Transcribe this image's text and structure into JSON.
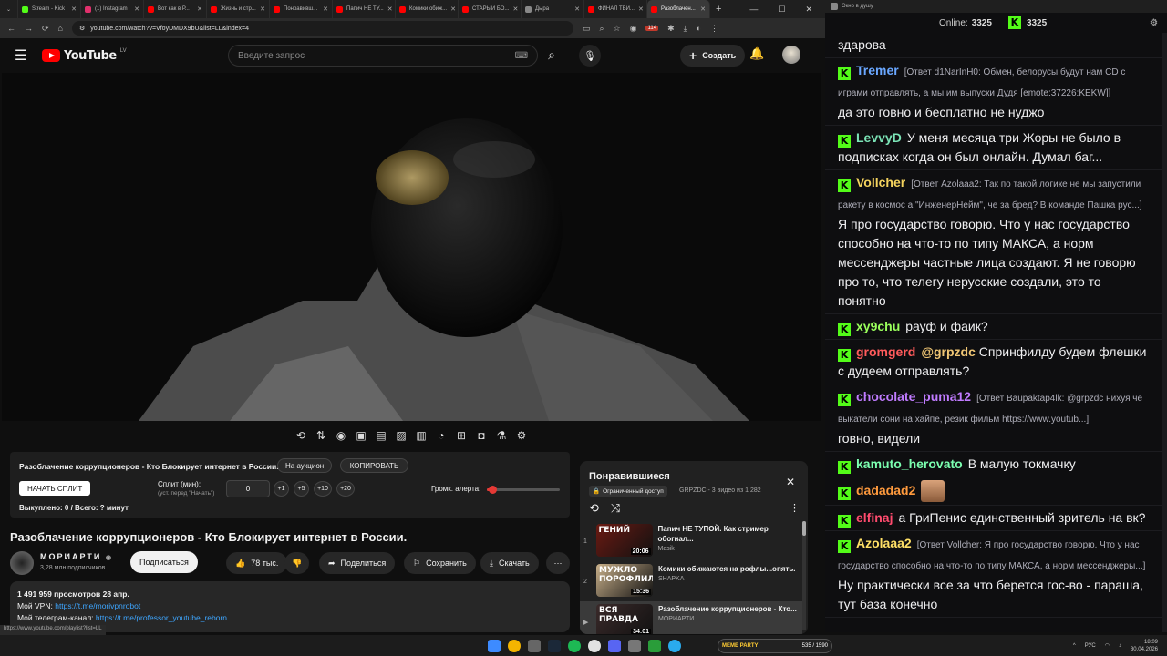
{
  "browser": {
    "tabs": [
      {
        "label": "Stream - Kick",
        "color": "#53fc18"
      },
      {
        "label": "(1) Instagram",
        "color": "#e1306c"
      },
      {
        "label": "Вот как в Р...",
        "color": "#ff0000"
      },
      {
        "label": "Жизнь и стр...",
        "color": "#ff0000"
      },
      {
        "label": "Понравивш...",
        "color": "#ff0000"
      },
      {
        "label": "Папич НЕ ТУ...",
        "color": "#ff0000"
      },
      {
        "label": "Комики обиж...",
        "color": "#ff0000"
      },
      {
        "label": "СТАРЫЙ БО...",
        "color": "#ff0000"
      },
      {
        "label": "Дыра",
        "color": "#888888"
      },
      {
        "label": "ФИНАЛ ТВИ...",
        "color": "#ff0000"
      },
      {
        "label": "Разоблачен...",
        "color": "#ff0000"
      }
    ],
    "url": "youtube.com/watch?v=VfoyDMDX9bU&list=LL&index=4",
    "status_url": "https://www.youtube.com/playlist?list=LL",
    "badge": "114"
  },
  "yt": {
    "logo": "YouTube",
    "region": "LV",
    "search_placeholder": "Введите запрос",
    "create": "Создать"
  },
  "split": {
    "title": "Разоблачение коррупционеров - Кто Блокирует интернет в России.",
    "auction": "На аукцион",
    "copy": "КОПИРОВАТЬ",
    "start": "НАЧАТЬ СПЛИТ",
    "split_label": "Сплит (мин):",
    "split_hint": "(уст. перед \"Начать\")",
    "value": "0",
    "b1": "+1",
    "b5": "+5",
    "b10": "+10",
    "b20": "+20",
    "volume_label": "Громк. алерта:",
    "volume": 0.08,
    "done": "Выкуплено: 0 / Всего: ? минут"
  },
  "video": {
    "title": "Разоблачение коррупционеров - Кто Блокирует интернет в России.",
    "channel": "МОРИАРТИ",
    "subs": "3,28 млн подписчиков",
    "subscribe": "Подписаться",
    "likes": "78 тыс.",
    "share": "Поделиться",
    "save": "Сохранить",
    "download": "Скачать",
    "views": "1 491 959 просмотров  28 апр.",
    "vpn_label": "Мой VPN: ",
    "vpn_link": "https://t.me/morivpnrobot",
    "tg_label": "Мой телеграм-канал: ",
    "tg_link": "https://t.me/professor_youtube_reborn"
  },
  "playlist": {
    "title": "Понравившиеся",
    "access": "Ограниченный доступ",
    "meta": "GRPZDC - 3 видео из 1 282",
    "items": [
      {
        "num": "1",
        "title": "Папич НЕ ТУПОЙ. Как стример обогнал...",
        "channel": "Masik",
        "dur": "20:06",
        "thumb_text": "ГЕНИЙ",
        "color": "#6b1a12"
      },
      {
        "num": "2",
        "title": "Комики обижаются на рофлы...опять.",
        "channel": "SHAPKA",
        "dur": "15:36",
        "thumb_text": "МУЖЛО ПОРОФЛИЛ",
        "color": "#c9b08a"
      },
      {
        "num": "▶",
        "title": "Разоблачение коррупционеров - Кто...",
        "channel": "МОРИАРТИ",
        "dur": "34:01",
        "thumb_text": "ВСЯ ПРАВДА",
        "color": "#3a2a2a"
      }
    ]
  },
  "chat": {
    "window_title": "Окно в душу",
    "online_label": "Online:",
    "online": "3325",
    "kick_count": "3325",
    "messages": [
      {
        "user": "",
        "color": "#fff",
        "reply": "",
        "text": "здарова"
      },
      {
        "user": "Tremer",
        "color": "#6aa7ff",
        "reply": "[Ответ d1NarInH0: Обмен, белорусы будут нам CD с играми отправлять, а мы им выпуски Дудя [emote:37226:KEKW]]",
        "text": "да это говно и бесплатно не нуджо"
      },
      {
        "user": "LevvyD",
        "color": "#7be3b6",
        "reply": "",
        "text": "У меня месяца три Жоры не было в подписках когда он был онлайн. Думал баг..."
      },
      {
        "user": "Vollcher",
        "color": "#f4d35e",
        "reply": "[Ответ Azolaaa2: Так по такой логике не мы запустили ракету в космос а \"ИнженерНейм\", че за бред? В команде Пашка рус...]",
        "text": "Я про государство говорю. Что у нас государство способно на что-то по типу МАКСА, а норм мессенджеры частные лица создают. Я не говорю про то, что телегу нерусские создали, это то понятно"
      },
      {
        "user": "xy9chu",
        "color": "#9aff5c",
        "reply": "",
        "text": "рауф и фаик?"
      },
      {
        "user": "gromgerd",
        "color": "#ff5b5b",
        "reply": "",
        "mention": "@grpzdc",
        "text": "Спринфилду будем флешки с дудеем отправлять?"
      },
      {
        "user": "chocolate_puma12",
        "color": "#c07bff",
        "reply": "[Ответ Baupaktap4lk: @grpzdc нихуя че выкатели сони на хайпе, резик фильм https://www.youtub...]",
        "text": "говно, видели"
      },
      {
        "user": "kamuto_herovato",
        "color": "#7bffb0",
        "reply": "",
        "text": "В малую токмачку"
      },
      {
        "user": "dadadad2",
        "color": "#ff9a3d",
        "reply": "",
        "text": ""
      },
      {
        "user": "elfinaj",
        "color": "#ff4b6e",
        "reply": "",
        "text": "а ГриПенис единственный зритель на вк?"
      },
      {
        "user": "Azolaaa2",
        "color": "#ffe066",
        "reply": "[Ответ Vollcher: Я про государство говорю. Что у нас государство способно на что-то по типу МАКСА, а норм мессенджеры...]",
        "text": "Ну практически все за что берется гос-во - параша, тут база конечно"
      }
    ]
  },
  "taskbar": {
    "lang": "РУС",
    "time": "18:09",
    "date": "30.04.2026",
    "widget": "535 / 1590",
    "widget_title": "MEME PARTY"
  }
}
